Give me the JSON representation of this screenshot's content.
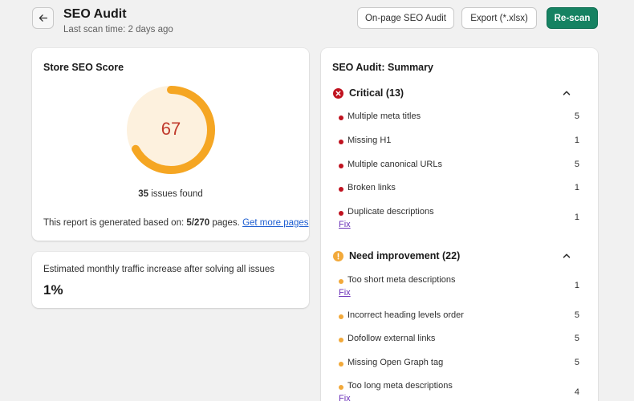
{
  "header": {
    "title": "SEO Audit",
    "last_scan": "Last scan time: 2 days ago",
    "buttons": {
      "onpage": "On-page SEO Audit",
      "export": "Export (*.xlsx)",
      "rescan": "Re-scan"
    }
  },
  "score_card": {
    "title": "Store SEO Score",
    "score": "67",
    "score_fraction": 0.67,
    "issues_count": "35",
    "issues_suffix": " issues found",
    "report_prefix": "This report is generated based on: ",
    "report_pages": "5/270",
    "report_suffix": " pages. ",
    "more_link": "Get more pages"
  },
  "traffic_card": {
    "label": "Estimated monthly traffic increase after solving all issues",
    "value": "1%"
  },
  "summary": {
    "title": "SEO Audit: Summary",
    "critical": {
      "title": "Critical (13)",
      "items": [
        {
          "label": "Multiple meta titles",
          "count": "5"
        },
        {
          "label": "Missing H1",
          "count": "1"
        },
        {
          "label": "Multiple canonical URLs",
          "count": "5"
        },
        {
          "label": "Broken links",
          "count": "1"
        },
        {
          "label": "Duplicate descriptions",
          "count": "1",
          "fix": "Fix"
        }
      ]
    },
    "improvement": {
      "title": "Need improvement (22)",
      "items": [
        {
          "label": "Too short meta descriptions",
          "count": "1",
          "fix": "Fix"
        },
        {
          "label": "Incorrect heading levels order",
          "count": "5"
        },
        {
          "label": "Dofollow external links",
          "count": "5"
        },
        {
          "label": "Missing Open Graph tag",
          "count": "5"
        },
        {
          "label": "Too long meta descriptions",
          "count": "4",
          "fix": "Fix"
        }
      ]
    }
  },
  "colors": {
    "primary": "#168262",
    "critical": "#c0121f",
    "warning": "#f2a93a",
    "gauge": "#f5a623",
    "gauge_track": "#fdf1de",
    "score_text": "#c0392b",
    "link": "#1f5fd1"
  }
}
